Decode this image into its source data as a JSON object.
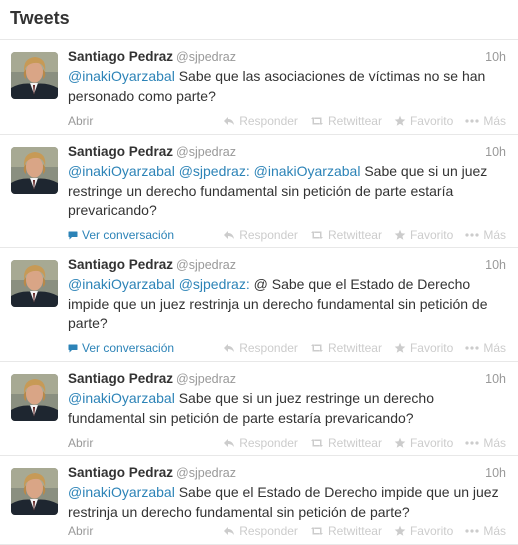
{
  "header": {
    "title": "Tweets"
  },
  "actions": {
    "reply": "Responder",
    "retweet": "Retwittear",
    "favorite": "Favorito",
    "more": "Más"
  },
  "colors": {
    "link": "#2c83b7",
    "muted": "#999999",
    "action": "#cccccc"
  },
  "icons": {
    "reply": "reply-arrow-icon",
    "retweet": "retweet-icon",
    "favorite": "star-icon",
    "more": "dots-icon",
    "conversation": "speech-bubble-icon"
  },
  "tweets": [
    {
      "name": "Santiago Pedraz",
      "handle": "@sjpedraz",
      "time": "10h",
      "mentions": [
        "@inakiOyarzabal"
      ],
      "text": "Sabe que las asociaciones de víctimas no se han personado como parte?",
      "link": "Abrir"
    },
    {
      "name": "Santiago Pedraz",
      "handle": "@sjpedraz",
      "time": "10h",
      "mentions": [
        "@inakiOyarzabal",
        "@sjpedraz:",
        "@inakiOyarzabal"
      ],
      "text": "Sabe que si un juez restringe un derecho fundamental sin petición de parte estaría prevaricando?",
      "link": "Ver conversación"
    },
    {
      "name": "Santiago Pedraz",
      "handle": "@sjpedraz",
      "time": "10h",
      "mentions": [
        "@inakiOyarzabal",
        "@sjpedraz:"
      ],
      "text": "@ Sabe que el Estado de Derecho impide que un juez restrinja un derecho fundamental sin petición de parte?",
      "link": "Ver conversación"
    },
    {
      "name": "Santiago Pedraz",
      "handle": "@sjpedraz",
      "time": "10h",
      "mentions": [
        "@inakiOyarzabal"
      ],
      "text": "Sabe que si un juez restringe un derecho fundamental sin petición de parte estaría prevaricando?",
      "link": "Abrir"
    },
    {
      "name": "Santiago Pedraz",
      "handle": "@sjpedraz",
      "time": "10h",
      "mentions": [
        "@inakiOyarzabal"
      ],
      "text": "Sabe que el Estado de Derecho impide que un juez restrinja un derecho fundamental sin petición de parte?",
      "link": "Abrir"
    }
  ]
}
